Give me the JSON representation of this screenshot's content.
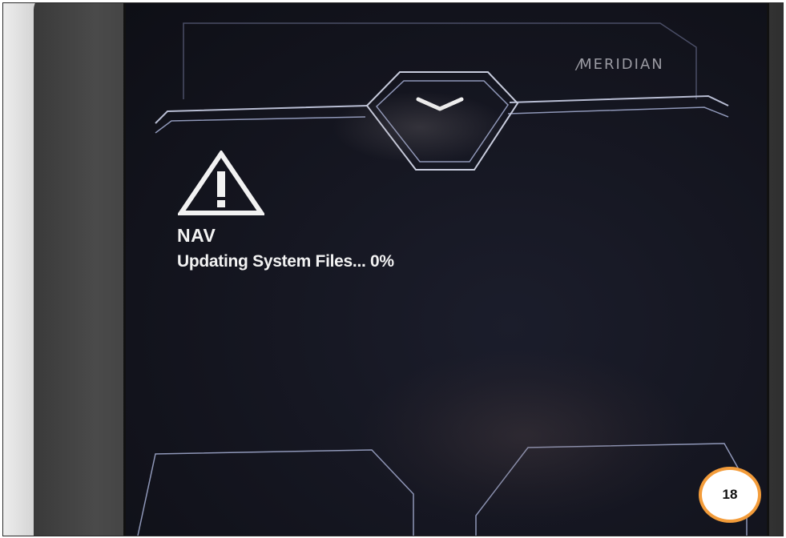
{
  "device": {
    "brand": "MERIDIAN"
  },
  "notice": {
    "icon": "warning-triangle-icon",
    "title": "NAV",
    "message": "Updating System Files... 0%",
    "progress_percent": 0
  },
  "page_badge": {
    "number": "18",
    "ring_color": "#f39c3a"
  },
  "colors": {
    "screen_bg": "#14151f",
    "text": "#f2f2f2",
    "outline": "#8f97b8"
  }
}
